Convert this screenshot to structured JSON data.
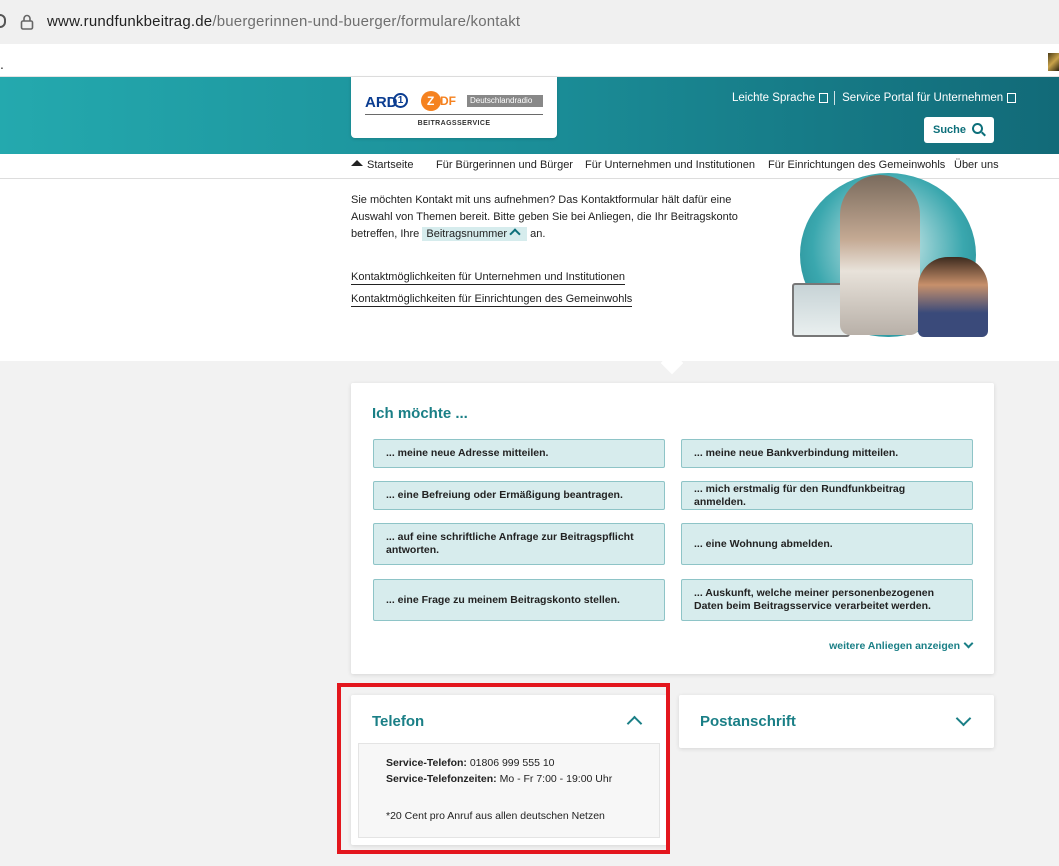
{
  "browser": {
    "url_domain": "www.rundfunkbeitrag.de",
    "url_path": "/buergerinnen-und-buerger/formulare/kontakt"
  },
  "header": {
    "logos": {
      "ard": "ARD",
      "ard_one": "1",
      "zdf_z": "Z",
      "zdf_df": "DF",
      "dradio": "Deutschlandradio",
      "service": "BEITRAGSSERVICE"
    },
    "leichte_sprache": "Leichte Sprache",
    "service_portal": "Service Portal für Unternehmen",
    "search_label": "Suche"
  },
  "nav": {
    "items": [
      "Startseite",
      "Für Bürgerinnen und Bürger",
      "Für Unternehmen und Institutionen",
      "Für Einrichtungen des Gemeinwohls",
      "Über uns"
    ]
  },
  "intro": {
    "text_1": "Sie möchten Kontakt mit uns aufnehmen? Das Kontaktformular hält dafür eine Auswahl von Themen bereit. Bitte geben Sie bei Anliegen, die Ihr Beitragskonto betreffen, Ihre",
    "tag": "Beitragsnummer",
    "text_2": "an.",
    "link_1": "Kontaktmöglichkeiten für Unternehmen und Institutionen",
    "link_2": "Kontaktmöglichkeiten für Einrichtungen des Gemeinwohls"
  },
  "options": {
    "title": "Ich möchte ...",
    "items": [
      "... meine neue Adresse mitteilen.",
      "... meine neue Bankverbindung mitteilen.",
      "... eine Befreiung oder Ermäßigung beantragen.",
      "... mich erstmalig für den Rundfunkbeitrag anmelden.",
      "... auf eine schriftliche Anfrage zur Beitragspflicht antworten.",
      "... eine Wohnung abmelden.",
      "... eine Frage zu meinem Beitragskonto stellen.",
      "... Auskunft, welche meiner personenbezogenen Daten beim Beitragsservice verarbeitet werden."
    ],
    "more": "weitere Anliegen anzeigen"
  },
  "telefon": {
    "title": "Telefon",
    "phone_label": "Service-Telefon:",
    "phone_value": " 01806 999 555 10",
    "hours_label": "Service-Telefonzeiten:",
    "hours_value": " Mo - Fr 7:00 - 19:00 Uhr",
    "note": "*20 Cent pro Anruf aus allen deutschen Netzen"
  },
  "post": {
    "title": "Postanschrift"
  },
  "colors": {
    "teal": "#1a7f86",
    "highlight": "#e3161d",
    "option_bg": "#d7eced"
  }
}
